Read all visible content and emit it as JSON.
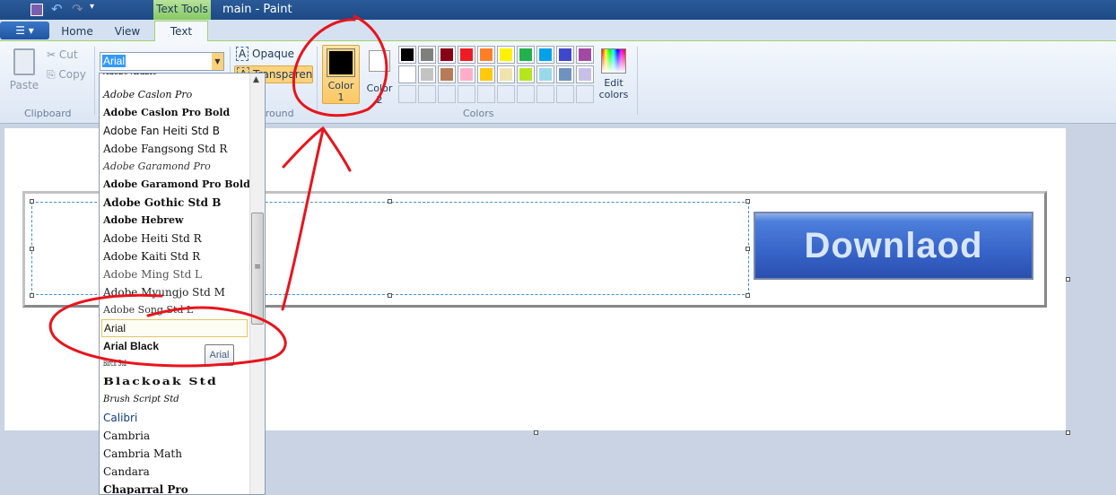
{
  "window": {
    "title": "main - Paint",
    "contextual_tab": "Text Tools"
  },
  "tabs": [
    {
      "label": "Home"
    },
    {
      "label": "View"
    },
    {
      "label": "Text"
    }
  ],
  "clipboard": {
    "paste": "Paste",
    "cut": "Cut",
    "copy": "Copy",
    "group": "Clipboard"
  },
  "font": {
    "value": "Arial",
    "tooltip": "Arial"
  },
  "background": {
    "opaque": "Opaque",
    "transparent": "Transparent",
    "group": "Background"
  },
  "colors": {
    "color1": "Color",
    "color1_num": "1",
    "color2": "Color",
    "color2_num": "2",
    "edit": "Edit",
    "edit2": "colors",
    "group": "Colors",
    "color1_value": "#000000",
    "color2_value": "#ffffff",
    "palette": [
      "#000000",
      "#7f7f7f",
      "#880015",
      "#ed1c24",
      "#ff7f27",
      "#fff200",
      "#22b14c",
      "#00a2e8",
      "#3f48cc",
      "#a349a4",
      "#ffffff",
      "#c3c3c3",
      "#b97a57",
      "#ffaec9",
      "#ffc90e",
      "#efe4b0",
      "#b5e61d",
      "#99d9ea",
      "#7092be",
      "#c8bfe7"
    ]
  },
  "font_list": [
    "Adobe Arabic",
    "Adobe Caslon Pro",
    "Adobe Caslon Pro Bold",
    "Adobe Fan Heiti Std B",
    "Adobe Fangsong Std R",
    "Adobe Garamond Pro",
    "Adobe Garamond Pro Bold",
    "Adobe Gothic Std B",
    "Adobe Hebrew",
    "Adobe Heiti Std R",
    "Adobe Kaiti Std R",
    "Adobe Ming Std L",
    "Adobe Myungjo Std M",
    "Adobe Song Std L",
    "Arial",
    "Arial Black",
    "Birch Std",
    "Blackoak Std",
    "Brush Script Std",
    "Calibri",
    "Cambria",
    "Cambria Math",
    "Candara",
    "Chaparral Pro"
  ],
  "selected_font": "Arial",
  "canvas": {
    "button_text": "Downlaod"
  },
  "annotation_color": "#e8141c"
}
